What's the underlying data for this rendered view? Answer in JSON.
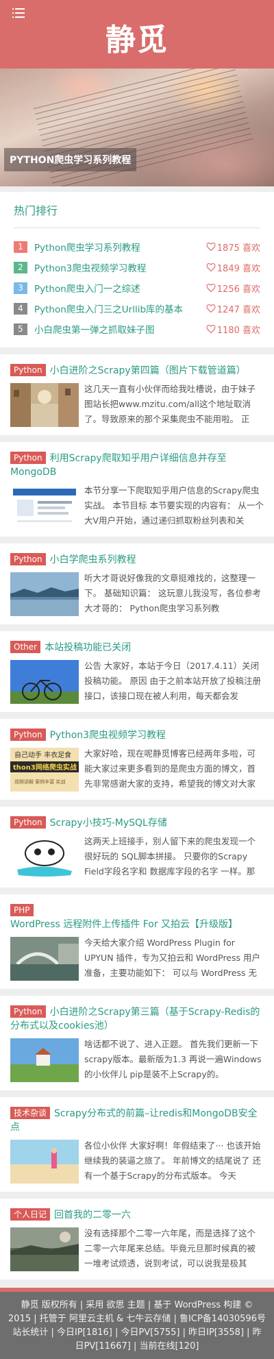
{
  "header": {
    "site_title": "静觅"
  },
  "hero": {
    "caption": "PYTHON爬虫学习系列教程"
  },
  "hot": {
    "title": "热门排行",
    "items": [
      {
        "rank": "1",
        "title": "Python爬虫学习系列教程",
        "likes": "1875 喜欢",
        "color": "#ee7b76"
      },
      {
        "rank": "2",
        "title": "Python3爬虫视频学习教程",
        "likes": "1849 喜欢",
        "color": "#5cb88a"
      },
      {
        "rank": "3",
        "title": "Python爬虫入门一之综述",
        "likes": "1256 喜欢",
        "color": "#7ab8e8"
      },
      {
        "rank": "4",
        "title": "Python爬虫入门三之Urllib库的基本",
        "likes": "1247 喜欢",
        "color": "#8a8a8a"
      },
      {
        "rank": "5",
        "title": "小白爬虫第一弹之抓取妹子图",
        "likes": "1180 喜欢",
        "color": "#8a8a8a"
      }
    ]
  },
  "posts": [
    {
      "category": "Python",
      "title": "小白进阶之Scrapy第四篇（图片下载管道篇）",
      "excerpt": "这几天一直有小伙伴而给我吐槽说，由于妹子图站长把www.mzitu.com/all这个地址取消了。导致原来的那个采集爬虫不能用啦。 正"
    },
    {
      "category": "Python",
      "title": "利用Scrapy爬取知乎用户详细信息并存至MongoDB",
      "excerpt": "本节分享一下爬取知乎用户信息的Scrapy爬虫实战。 本节目标 本节要实现的内容有： 从一个大V用户开始，通过递归抓取粉丝列表和关"
    },
    {
      "category": "Python",
      "title": "小白学爬虫系列教程",
      "excerpt": "听大才哥说好像我的文章挺难找的，这整理一下。 基础知识篇： 这玩意儿我没写，各位参考大才哥的： Python爬虫学习系列教"
    },
    {
      "category": "Other",
      "title": "本站投稿功能已关闭",
      "excerpt": "公告 大家好，本站于今日（2017.4.11）关闭投稿功能。 原因 由于之前本站开放了投稿注册接口，该接口现在被人利用，每天都会发"
    },
    {
      "category": "Python",
      "title": "Python3爬虫视频学习教程",
      "excerpt": "大家好哈，现在呢静觅博客已经两年多啦，可能大家过来更多看到的是爬虫方面的博文，首先非常感谢大家的支持，希望我的博文对大家"
    },
    {
      "category": "Python",
      "title": "Scrapy小技巧-MySQL存储",
      "excerpt": "这两天上班接手，别人留下来的爬虫发现一个很好玩的 SQL脚本拼接。 只要你的Scrapy Field字段名字和 数据库字段的名字 一样。那"
    },
    {
      "category": "PHP",
      "title": "WordPress 远程附件上传插件 For 又拍云【升级版】",
      "excerpt": "今天给大家介绍 WordPress Plugin for UPYUN 插件，专为又拍云和 WordPress 用户准备，主要功能如下： 可以与 WordPress 无缝结"
    },
    {
      "category": "Python",
      "title": "小白进阶之Scrapy第三篇（基于Scrapy-Redis的分布式以及cookies池）",
      "excerpt": "啥话都不说了、进入正题。 首先我们更新一下scrapy版本。最新版为1.3 再说一遍Windows的小伙伴儿 pip是装不上Scrapy的。"
    },
    {
      "category": "技术杂谈",
      "title": "Scrapy分布式的前篇–让redis和MongoDB安全点",
      "excerpt": "各位小伙伴 大家好啊！年假结束了··· 也该开始继续我的装逼之旅了。 年前博文的结尾说了 还有一个基于Scrapy的分布式版本。 今天"
    },
    {
      "category": "个人日记",
      "title": "回首我的二零一六",
      "excerpt": "没有选择那个二零一六年尾，而是选择了这个二零一六年尾来总结。毕竟元旦那时候真的被一堆考试烦透，说到考试，可以说我是极其"
    }
  ],
  "footer": {
    "copyright": "静觅 版权所有",
    "theme_prefix": "采用",
    "theme_name": "欲思",
    "theme_suffix": "主题",
    "built_prefix": "基于",
    "wordpress": "WordPress",
    "built_suffix": "构建 © 2015",
    "host_prefix": "托管于",
    "host_1": "阿里云主机",
    "host_and": "&",
    "host_2": "七牛云存储",
    "icp": "鲁ICP备14030596号",
    "stats": "站长统计 | 今日IP[1816] | 今日PV[5755] | 昨日IP[3558] | 昨日PV[11667] | 当前在线[120]"
  }
}
